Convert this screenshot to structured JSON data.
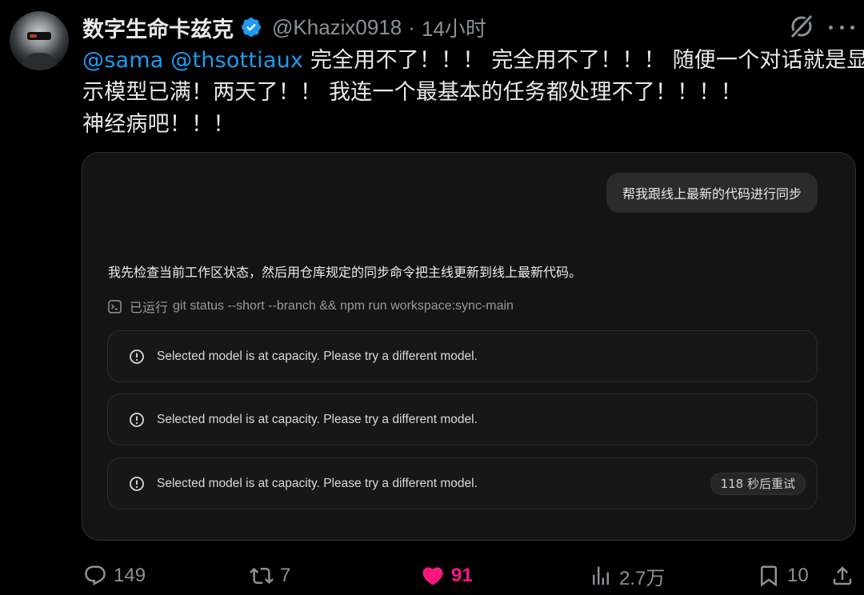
{
  "post": {
    "author": {
      "display_name": "数字生命卡兹克",
      "handle": "@Khazix0918",
      "separator": "·",
      "time": "14小时",
      "verified": true
    },
    "text": {
      "mention1": "@sama",
      "mention2": "@thsottiaux",
      "line1_rest": " 完全用不了！！！ 完全用不了！！！ 随便一个对话就是显",
      "line2": "示模型已满！两天了！！ 我连一个最基本的任务都处理不了！！！！",
      "line3": "神经病吧！！！"
    }
  },
  "card": {
    "user_message": "帮我跟线上最新的代码进行同步",
    "assistant_message": "我先检查当前工作区状态，然后用仓库规定的同步命令把主线更新到线上最新代码。",
    "command_prefix": "已运行",
    "command": "git status --short --branch && npm run workspace:sync-main",
    "errors": [
      {
        "text": "Selected model is at capacity. Please try a different model."
      },
      {
        "text": "Selected model is at capacity. Please try a different model."
      },
      {
        "text": "Selected model is at capacity. Please try a different model.",
        "retry": "118 秒后重试"
      }
    ]
  },
  "actions": {
    "replies": "149",
    "reposts": "7",
    "likes": "91",
    "views": "2.7万",
    "bookmarks": "10"
  },
  "icons": {
    "verified": "verified-badge-icon",
    "grok": "grok-icon",
    "more": "more-icon",
    "terminal": "terminal-icon",
    "error": "alert-circle-icon",
    "reply": "reply-icon",
    "repost": "repost-icon",
    "like": "heart-icon",
    "views": "views-icon",
    "bookmark": "bookmark-icon",
    "share": "share-icon"
  },
  "colors": {
    "background": "#000000",
    "mention": "#1d9bf0",
    "verified": "#1d9bf0",
    "like": "#f91880",
    "muted": "#8b9196",
    "card": "#141414"
  }
}
